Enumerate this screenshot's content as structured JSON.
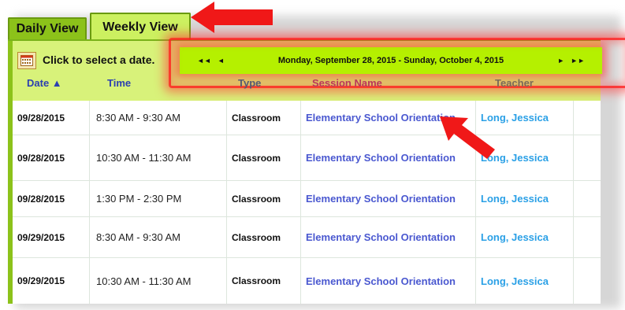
{
  "tabs": [
    {
      "label": "Daily View",
      "active": false
    },
    {
      "label": "Weekly View",
      "active": true
    }
  ],
  "toolbar": {
    "calendar_icon": "calendar-icon",
    "select_date_label": "Click to select a date.",
    "nav": {
      "first": "◄◄",
      "prev": "◄",
      "next": "►",
      "last": "►►"
    },
    "range_text": "Monday, September 28, 2015 - Sunday, October 4, 2015"
  },
  "columns": {
    "date": "Date ▲",
    "time": "Time",
    "type": "Type",
    "session": "Session Name",
    "teacher": "Teacher"
  },
  "rows": [
    {
      "date": "09/28/2015",
      "time": "8:30 AM - 9:30 AM",
      "type": "Classroom",
      "session": "Elementary School Orientation",
      "teacher": "Long, Jessica"
    },
    {
      "date": "09/28/2015",
      "time": "10:30 AM - 11:30 AM",
      "type": "Classroom",
      "session": "Elementary School Orientation",
      "teacher": "Long, Jessica"
    },
    {
      "date": "09/28/2015",
      "time": "1:30 PM - 2:30 PM",
      "type": "Classroom",
      "session": "Elementary School Orientation",
      "teacher": "Long, Jessica"
    },
    {
      "date": "09/29/2015",
      "time": "8:30 AM - 9:30 AM",
      "type": "Classroom",
      "session": "Elementary School Orientation",
      "teacher": "Long, Jessica"
    },
    {
      "date": "09/29/2015",
      "time": "10:30 AM - 11:30 AM",
      "type": "Classroom",
      "session": "Elementary School Orientation",
      "teacher": "Long, Jessica"
    }
  ],
  "colors": {
    "tab_active": "#ccf060",
    "tab_inactive": "#8cc21a",
    "nav_bar": "#b5f000",
    "highlight": "#ff2020",
    "link_session": "#4a58d0",
    "link_teacher": "#2aa0e6"
  }
}
